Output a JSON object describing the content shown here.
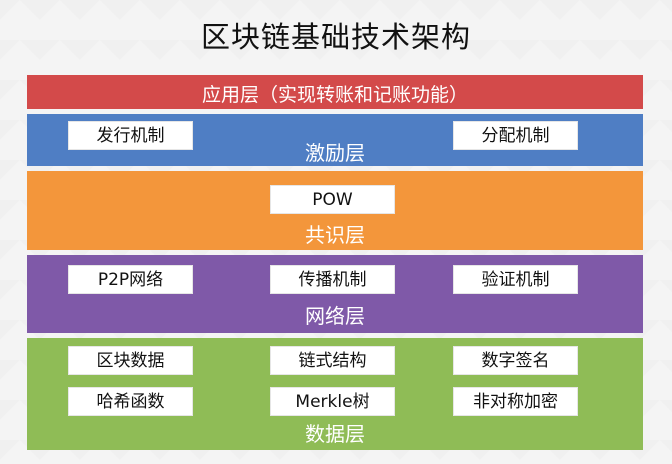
{
  "title": "区块链基础技术架构",
  "layers": {
    "application": {
      "name": "应用层（实现转账和记账功能）",
      "color": "#d34a4a"
    },
    "incentive": {
      "name": "激励层",
      "color": "#4f7ec4",
      "items": [
        "发行机制",
        "分配机制"
      ]
    },
    "consensus": {
      "name": "共识层",
      "color": "#f3963b",
      "items": [
        "POW"
      ]
    },
    "network": {
      "name": "网络层",
      "color": "#7f59a8",
      "items": [
        "P2P网络",
        "传播机制",
        "验证机制"
      ]
    },
    "data": {
      "name": "数据层",
      "color": "#8fbc56",
      "items": [
        "区块数据",
        "链式结构",
        "数字签名",
        "哈希函数",
        "Merkle树",
        "非对称加密"
      ]
    }
  }
}
